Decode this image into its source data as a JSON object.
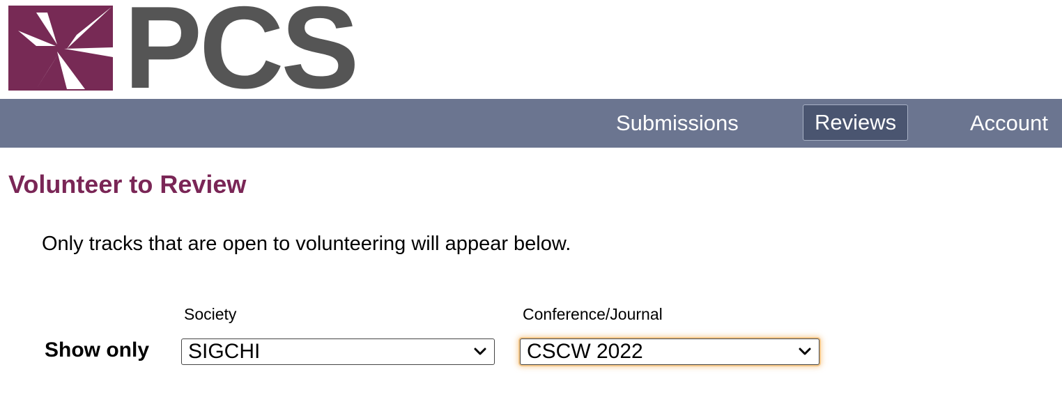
{
  "brand": {
    "name": "PCS",
    "logo_color": "#772a55",
    "text_color": "#555555"
  },
  "nav": {
    "items": [
      {
        "label": "Submissions",
        "active": false
      },
      {
        "label": "Reviews",
        "active": true
      },
      {
        "label": "Account",
        "active": false
      }
    ],
    "bar_color": "#6b7590"
  },
  "page": {
    "title": "Volunteer to Review",
    "title_color": "#7a2656",
    "intro": "Only tracks that are open to volunteering will appear below."
  },
  "filters": {
    "show_only_label": "Show only",
    "society": {
      "label": "Society",
      "selected": "SIGCHI"
    },
    "conference": {
      "label": "Conference/Journal",
      "selected": "CSCW 2022",
      "focused": true
    }
  },
  "icons": [
    "pcs-logo-mark-icon",
    "chevron-down-icon"
  ]
}
